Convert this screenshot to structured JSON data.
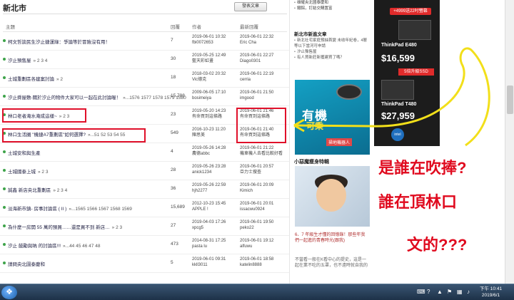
{
  "board": {
    "title": "新北市",
    "post_button": "發表文章"
  },
  "columns": {
    "topic": "主題",
    "replies": "回覆",
    "author": "作者",
    "last_reply": "最新回覆"
  },
  "threads": [
    {
      "title": "柯文哲談民生汐止捷運綠：爭論等於冒險沒有用！",
      "pages": "",
      "replies": "7",
      "author_time": "2019-06-01 10:32",
      "author": "fbi0072653",
      "last_time": "2019-06-01 22:32",
      "last_user": "Eric Cha"
    },
    {
      "title": "汐止預售屋",
      "pages": "» 2 3 4",
      "replies": "30",
      "author_time": "2019-05-25 12:49",
      "author": "藍天彩虹畫",
      "last_time": "2019-06-01 22:27",
      "last_user": "Diago0301"
    },
    {
      "title": "土城重劃區各建案討論",
      "pages": "» 2",
      "replies": "18",
      "author_time": "2018-03-02 20:32",
      "author": "Vic德克",
      "last_time": "2019-06-01 22:19",
      "last_user": "cerria"
    },
    {
      "title": "汐止舜屋敷-關於汐止的物件大家可以一起在此討論喔！",
      "pages": "»...1576 1577 1578 1579 1580",
      "replies": "15,798",
      "author_time": "2009-06-05 17:10",
      "author": "bosimeiya",
      "last_time": "2019-06-01 21:50",
      "last_user": "imgood"
    },
    {
      "title": "林口老者淹水淹成這樣~",
      "pages": "» 2 3",
      "replies": "23",
      "author_time": "2019-05-20 14:23",
      "author": "有命買到這條路",
      "last_time": "2019-06-01 21:46",
      "last_user": "有命買到這條路"
    },
    {
      "title": "林口生活圈 \"機捷A7重劃區\"如何選擇?",
      "pages": "»...51 52 53 54 55",
      "replies": "549",
      "author_time": "2016-10-23 11:20",
      "author": "陳思美",
      "last_time": "2019-06-01 21:40",
      "last_user": "有命買到這條路"
    },
    {
      "title": "土城安和與生產",
      "pages": "",
      "replies": "4",
      "author_time": "2019-05-26 14:28",
      "author": "農德abbc",
      "last_time": "2019-06-01 21:22",
      "last_user": "機車機人去看比較好看"
    },
    {
      "title": "土城國泰上城",
      "pages": "» 2 3",
      "replies": "28",
      "author_time": "2019-05-26 23:28",
      "author": "anick1234",
      "last_time": "2019-06-01 20:57",
      "last_user": "亞力士搜查"
    },
    {
      "title": "誠鑫 新店央北重劃區",
      "pages": "» 2 3 4",
      "replies": "36",
      "author_time": "2019-05-26 22:59",
      "author": "hjh2277",
      "last_time": "2019-06-01 20:09",
      "last_user": "Kimich"
    },
    {
      "title": "淡海新市鎮- 房事討論區 ( II )",
      "pages": "»...1565 1566 1567 1568 1569",
      "replies": "15,689",
      "author_time": "2012-10-23 15:45",
      "author": "APPLE !",
      "last_time": "2019-06-01 20:01",
      "last_user": "issacwu0924"
    },
    {
      "title": "為什麼一房開 55 萬的預買……還是買不到 新店…",
      "pages": "» 2 3",
      "replies": "27",
      "author_time": "2019-04-03 17:26",
      "author": "xpcg5",
      "last_time": "2019-06-01 19:50",
      "last_user": "peko22"
    },
    {
      "title": "汐止 鼓勵與吶 的討論區!!!",
      "pages": "»...44 45 46 47 48",
      "replies": "473",
      "author_time": "2014-08-31 17:25",
      "author": "pasta lu",
      "last_time": "2019-06-01 19:12",
      "last_user": "alfuwu"
    },
    {
      "title": "請問央北園泰慶和",
      "pages": "",
      "replies": "5",
      "author_time": "2019-06-01 09:31",
      "author": "kkll3011",
      "last_time": "2019-06-01 18:58",
      "last_user": "katelin8888"
    }
  ],
  "sidebar": {
    "top_links": [
      "雄耀央北國泰慶和",
      "鐵鋁，訂結交購置富"
    ],
    "news_title": "新北市新進文章",
    "news_items": [
      "新北社宅家庭預抽首變 未收年紀卷，4層等以下當河可申請",
      "汐止豫售屋",
      "有人買新莊新獲建買了嗎？"
    ],
    "robot_ad": {
      "line1": "有機",
      "line2": "可乘",
      "line3": "掃地機器人"
    },
    "section_title": "小惡魔瘦身特輯",
    "kid_caption": "6、7 年級生才懂的回憶錄！那些年我們一起進的青春時光(跟我)",
    "kid_text": "不當看一般在K看中心的提史，這是一起在業不吃的五罩，也不遠時就自我的"
  },
  "laptop_ad": {
    "badge": "+4999送22吋螢幕",
    "model1": "ThinkPad E480",
    "price1": "$16,599",
    "ssd": "5倍升級SSD",
    "model2": "ThinkPad T480",
    "price2": "$27,959",
    "intel": "intel"
  },
  "annotation": {
    "line1": "是誰在吹捧?",
    "line2": "誰在頂林口",
    "line3": "文的???"
  },
  "taskbar": {
    "start": "❖",
    "clock_time": "下午 10:41",
    "clock_date": "2019/6/1"
  },
  "colors": {
    "annotation": "#e00a1e",
    "dot": "#3ea34a",
    "arrow": "#f2df1a"
  }
}
